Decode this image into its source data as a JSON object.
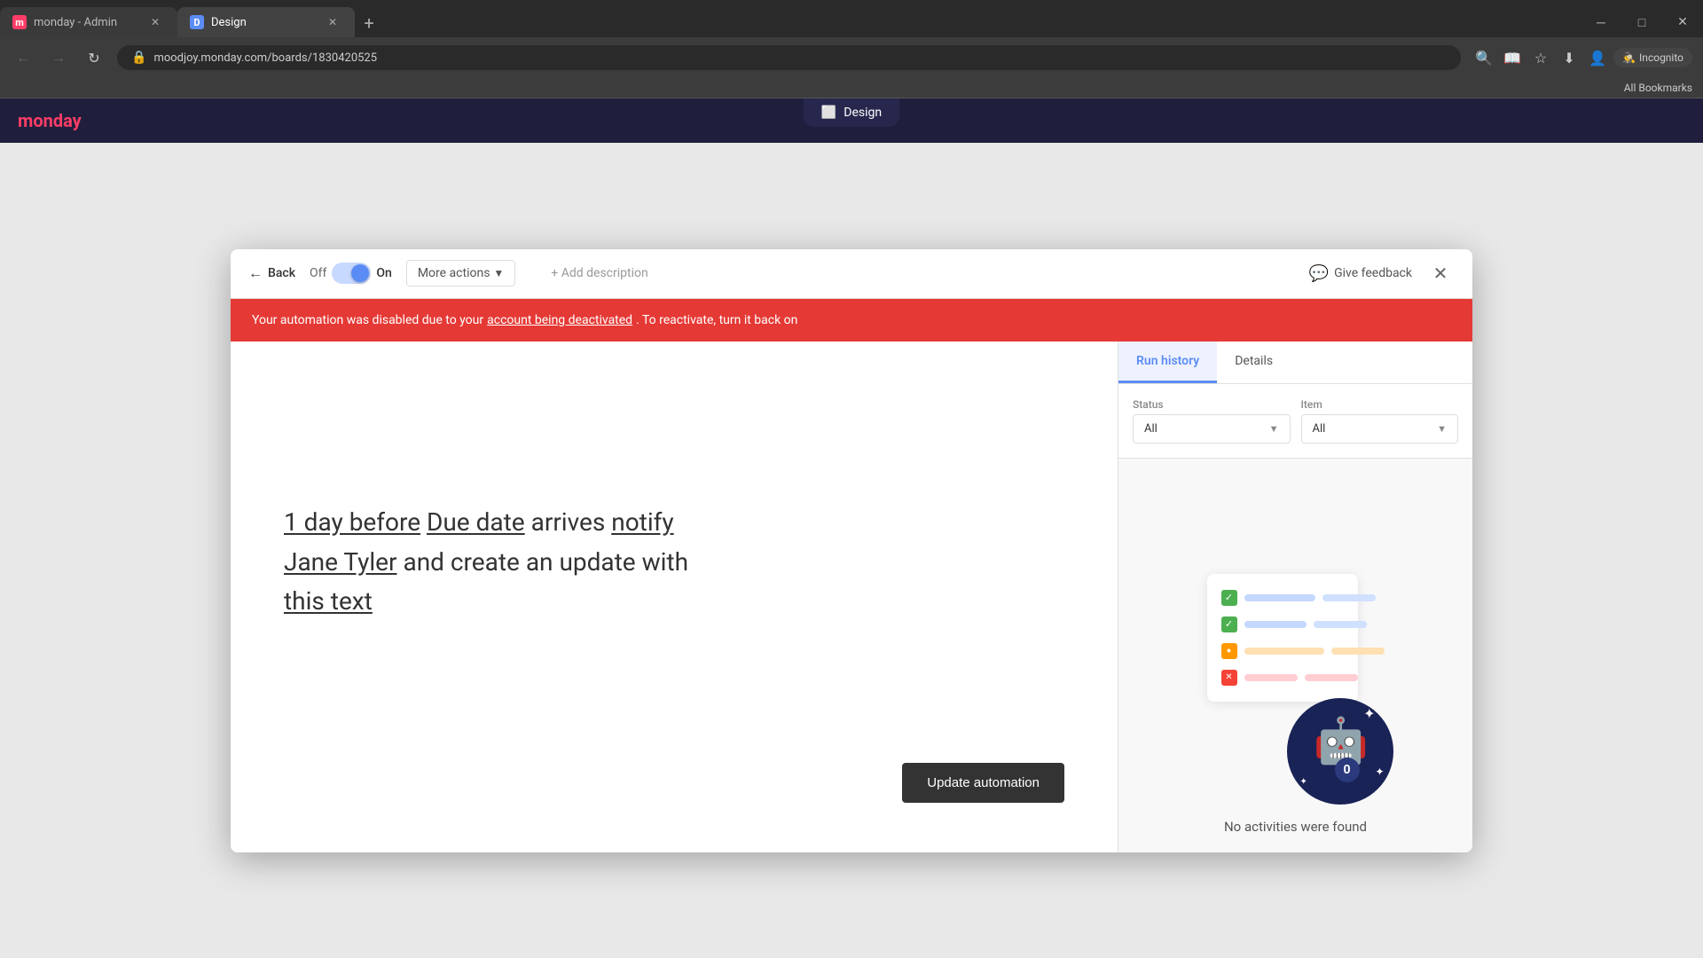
{
  "browser": {
    "tabs": [
      {
        "id": "admin",
        "favicon_color": "#ff3d67",
        "favicon_letter": "m",
        "title": "monday - Admin",
        "active": false
      },
      {
        "id": "design",
        "favicon_color": "#5b8cf5",
        "favicon_letter": "d",
        "title": "Design",
        "active": true
      }
    ],
    "new_tab_label": "+",
    "address": "moodjoy.monday.com/boards/1830420525",
    "window_controls": {
      "minimize": "─",
      "maximize": "□",
      "close": "✕"
    }
  },
  "address_bar": {
    "url": "moodjoy.monday.com/boards/1830420525"
  },
  "bookmarks": {
    "label": "All Bookmarks"
  },
  "design_pill": {
    "label": "Design",
    "icon": "⬜"
  },
  "toolbar": {
    "back_label": "Back",
    "off_label": "Off",
    "on_label": "On",
    "more_actions_label": "More actions",
    "add_description_label": "+ Add description",
    "give_feedback_label": "Give feedback",
    "close_label": "✕"
  },
  "alert": {
    "message_before": "Your automation was disabled due to your ",
    "link_text": "account being deactivated",
    "message_after": ". To reactivate, turn it back on"
  },
  "automation": {
    "part1": "1 day before",
    "part2": "Due date",
    "part3": "arrives",
    "part4": "notify",
    "part5": "Jane Tyler",
    "part6": "and create an update with",
    "part7": "this text",
    "update_button_label": "Update automation"
  },
  "run_history_panel": {
    "tabs": [
      {
        "id": "run-history",
        "label": "Run history",
        "active": true
      },
      {
        "id": "details",
        "label": "Details",
        "active": false
      }
    ],
    "status_filter": {
      "label": "Status",
      "value": "All"
    },
    "item_filter": {
      "label": "Item",
      "value": "All"
    },
    "empty_text": "No activities were found"
  },
  "illustration": {
    "rows": [
      {
        "checkbox_color": "green",
        "checkbox_icon": "✓"
      },
      {
        "checkbox_color": "green",
        "checkbox_icon": "✓"
      },
      {
        "checkbox_color": "orange",
        "checkbox_icon": "○"
      },
      {
        "checkbox_color": "red",
        "checkbox_icon": "✕"
      }
    ]
  }
}
